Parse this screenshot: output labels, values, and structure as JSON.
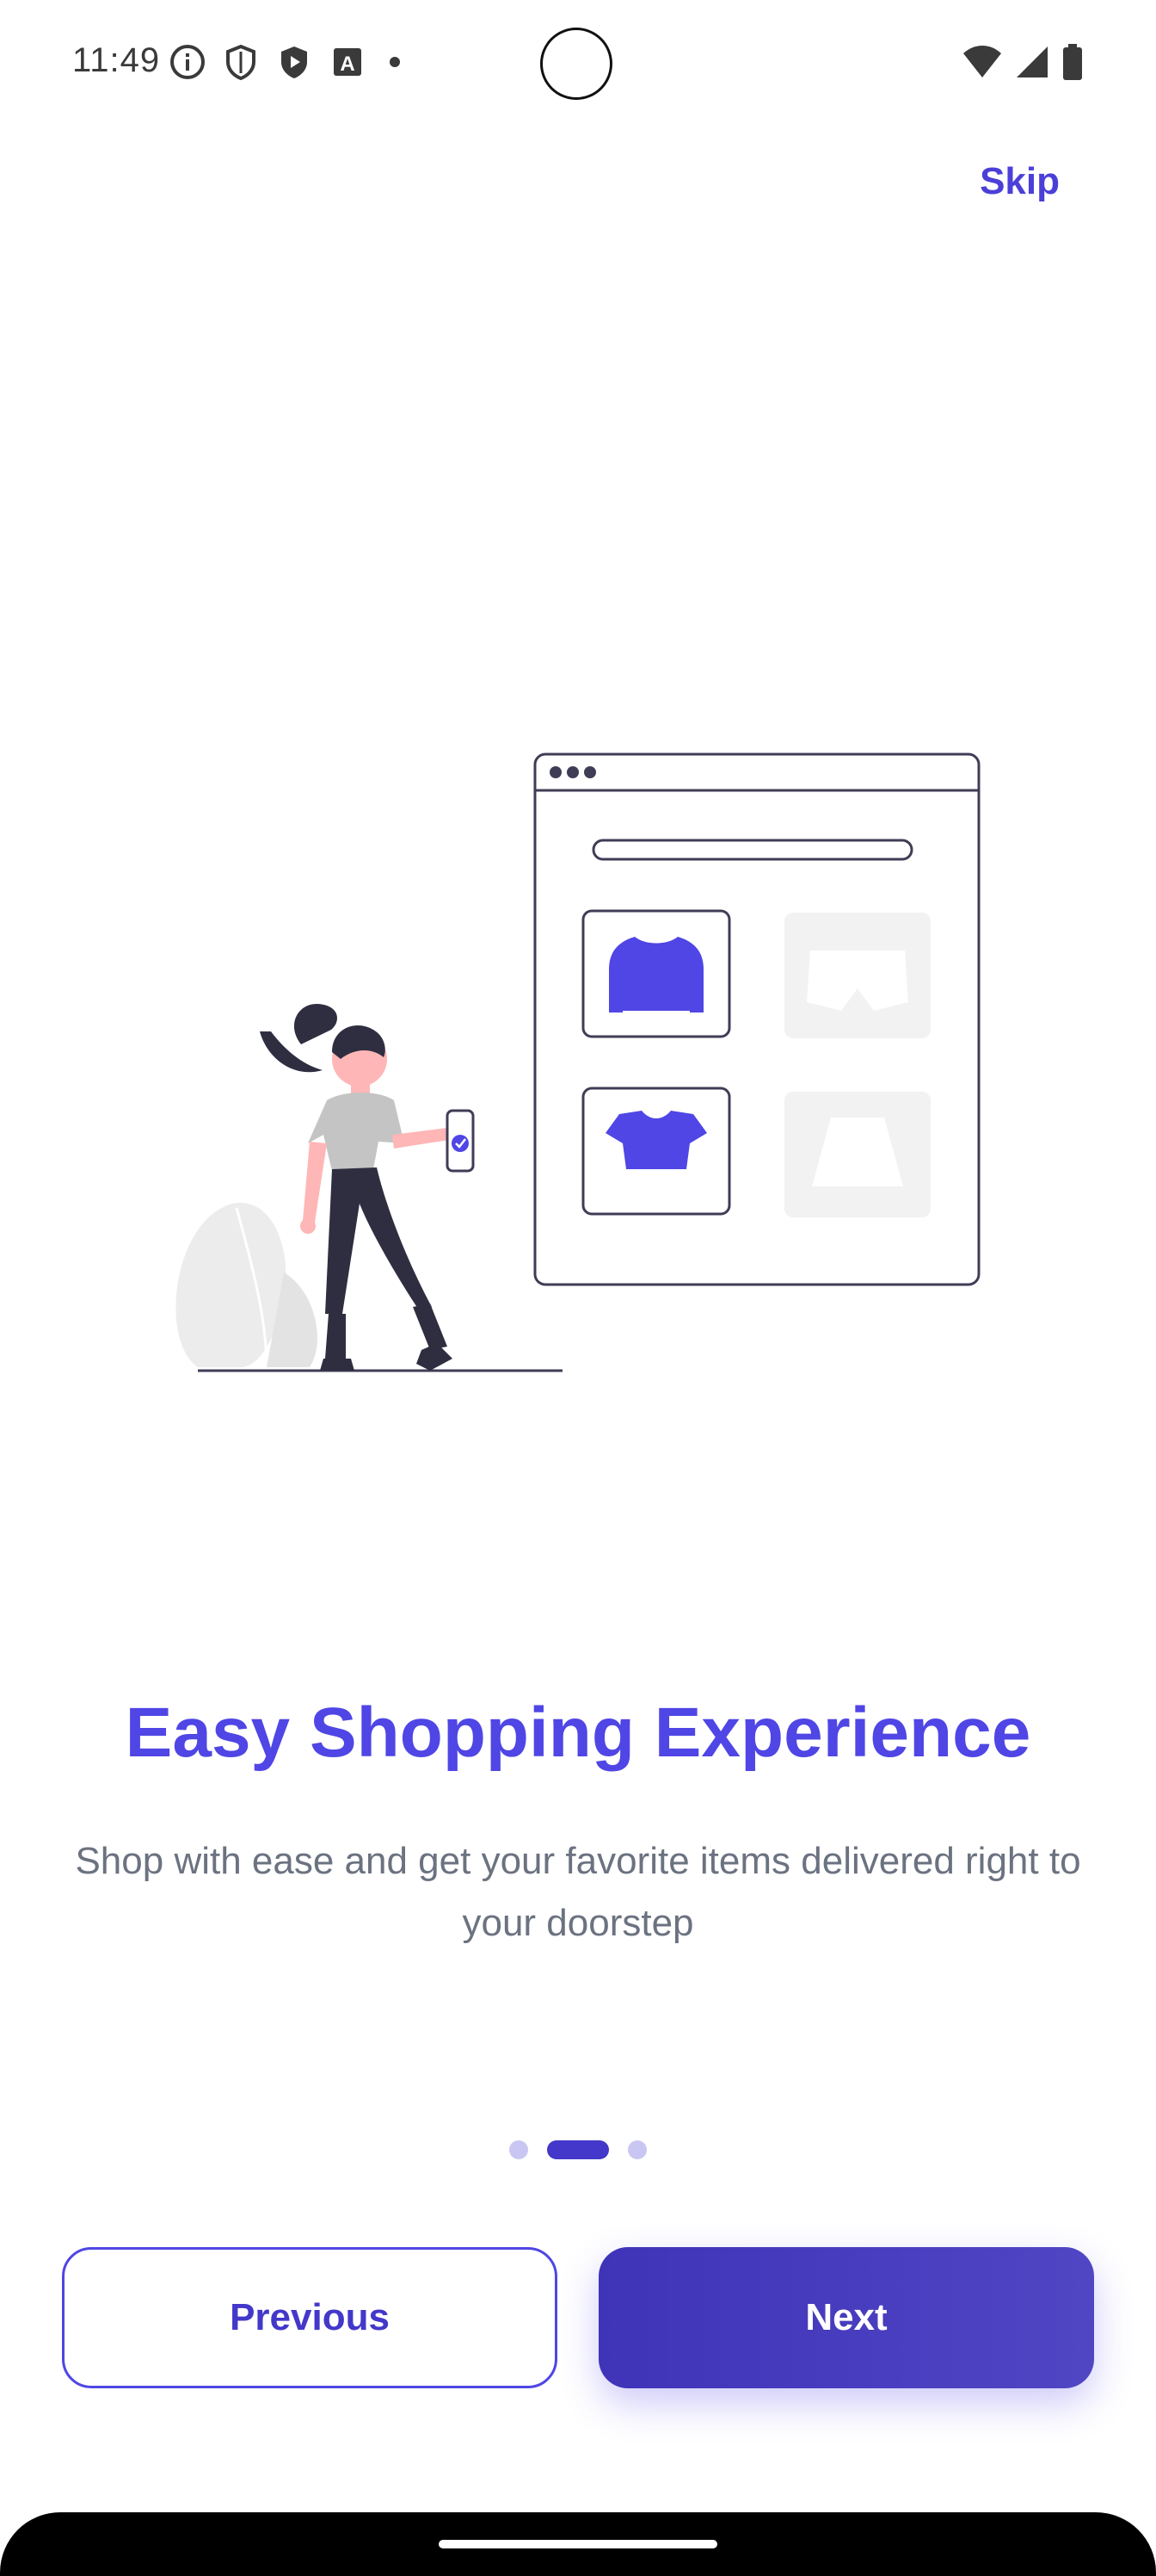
{
  "status_bar": {
    "time": "11:49",
    "left_icons": [
      "info-icon",
      "shield-icon",
      "play-protect-icon",
      "font-a-icon",
      "dot-icon"
    ],
    "right_icons": [
      "wifi-icon",
      "signal-icon",
      "battery-icon"
    ]
  },
  "header": {
    "skip_label": "Skip"
  },
  "illustration": {
    "accent_color": "#4f46e5",
    "items": [
      "sweater-icon",
      "shorts-icon",
      "top-icon",
      "skirt-icon"
    ]
  },
  "content": {
    "title": "Easy Shopping Experience",
    "subtitle": "Shop with ease and get your favorite items delivered right to your doorstep"
  },
  "pager": {
    "total": 3,
    "active_index": 1
  },
  "buttons": {
    "previous_label": "Previous",
    "next_label": "Next"
  },
  "colors": {
    "primary": "#4f46e5",
    "primary_dark": "#4338ca",
    "subtitle_text": "#6b7280",
    "dot_inactive": "#c9c6f3"
  }
}
